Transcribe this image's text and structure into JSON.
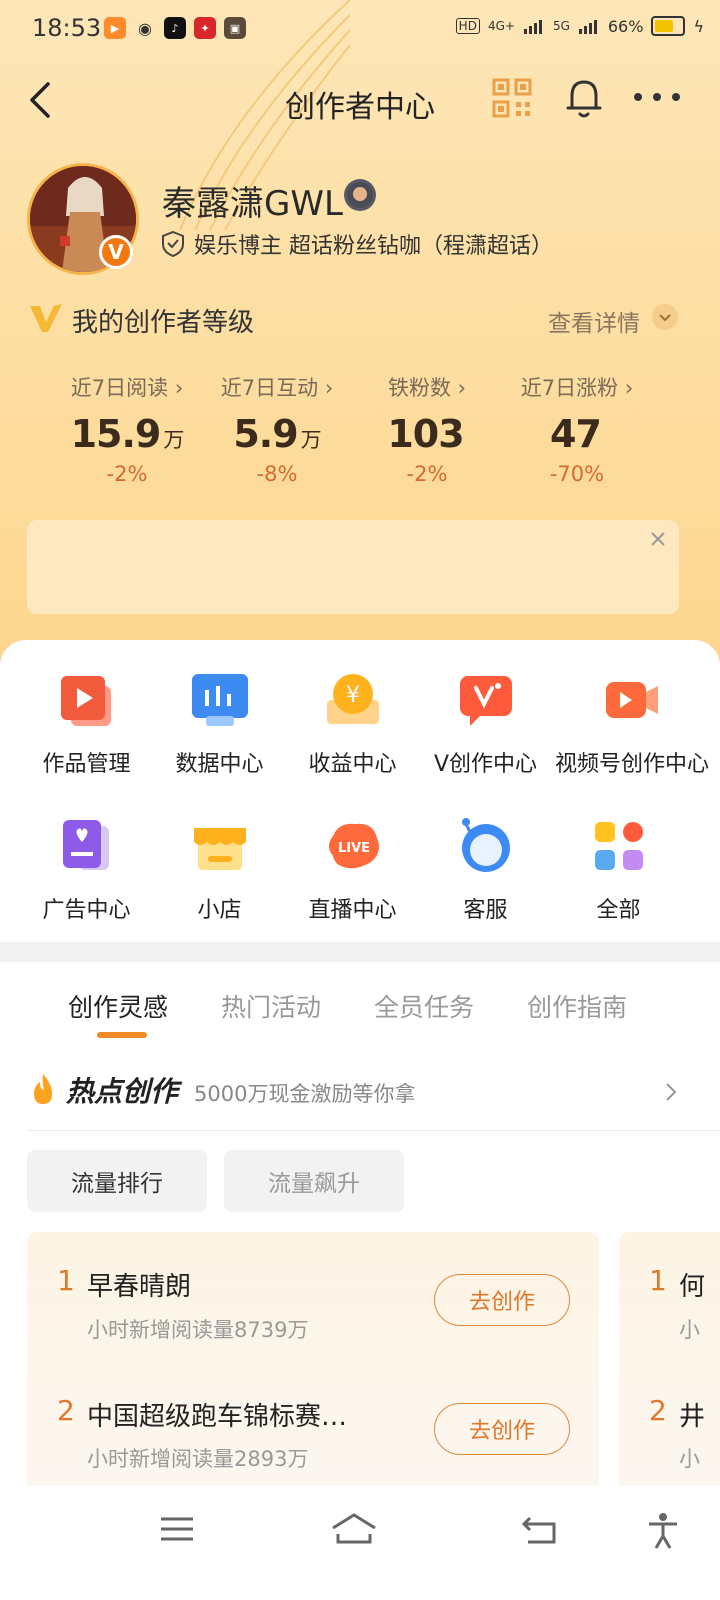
{
  "status_bar": {
    "time": "18:53",
    "network_1": "4G+",
    "network_2": "5G",
    "battery": "66%"
  },
  "header": {
    "title": "创作者中心"
  },
  "profile": {
    "username": "秦露潇GWL",
    "verification": "娱乐博主 超话粉丝钻咖（程潇超话）",
    "badge": "V"
  },
  "level": {
    "title": "我的创作者等级",
    "detail_link": "查看详情"
  },
  "stats": [
    {
      "label": "近7日阅读",
      "value": "15.9",
      "unit": "万",
      "change": "-2%"
    },
    {
      "label": "近7日互动",
      "value": "5.9",
      "unit": "万",
      "change": "-8%"
    },
    {
      "label": "铁粉数",
      "value": "103",
      "unit": "",
      "change": "-2%"
    },
    {
      "label": "近7日涨粉",
      "value": "47",
      "unit": "",
      "change": "-70%"
    }
  ],
  "tools_row1": [
    {
      "label": "作品管理",
      "icon": "works-icon"
    },
    {
      "label": "数据中心",
      "icon": "data-icon"
    },
    {
      "label": "收益中心",
      "icon": "income-icon"
    },
    {
      "label": "V创作中心",
      "icon": "v-creation-icon"
    },
    {
      "label": "视频号创作中心",
      "icon": "video-icon"
    }
  ],
  "tools_row2": [
    {
      "label": "广告中心",
      "icon": "ad-icon"
    },
    {
      "label": "小店",
      "icon": "shop-icon"
    },
    {
      "label": "直播中心",
      "icon": "live-icon"
    },
    {
      "label": "客服",
      "icon": "service-icon"
    },
    {
      "label": "全部",
      "icon": "all-icon"
    }
  ],
  "tabs": [
    "创作灵感",
    "热门活动",
    "全员任务",
    "创作指南"
  ],
  "hot": {
    "title": "热点创作",
    "subtitle": "5000万现金激励等你拿"
  },
  "filters": [
    "流量排行",
    "流量飙升"
  ],
  "trending": [
    {
      "rank": "1",
      "title": "早春晴朗",
      "sub": "小时新增阅读量8739万",
      "button": "去创作"
    },
    {
      "rank": "2",
      "title": "中国超级跑车锦标赛…",
      "sub": "小时新增阅读量2893万",
      "button": "去创作"
    }
  ],
  "trending_next": [
    {
      "rank": "1",
      "title": "何",
      "sub": "小"
    },
    {
      "rank": "2",
      "title": "井",
      "sub": "小"
    }
  ],
  "live_badge": "LIVE",
  "colors": {
    "accent": "#f08a24",
    "hero_bg": "#fde0a6",
    "change": "#d36c2e"
  }
}
